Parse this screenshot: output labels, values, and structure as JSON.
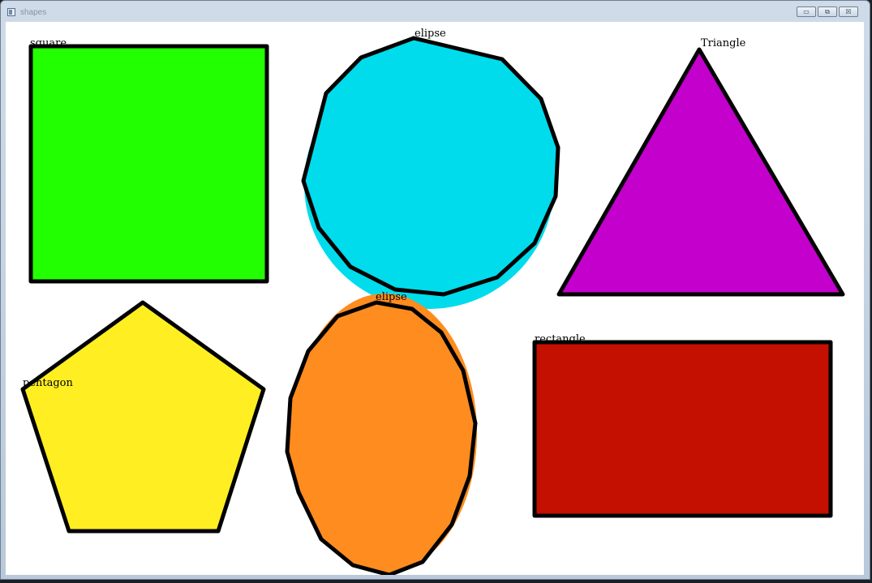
{
  "window": {
    "title": "shapes",
    "buttons": {
      "minimize": "▭",
      "maximize": "⧉",
      "close": "☒"
    }
  },
  "shapes": {
    "square": {
      "label": "square",
      "fill": "#22ff00"
    },
    "circle": {
      "label": "elipse",
      "fill": "#00dcec"
    },
    "triangle": {
      "label": "Triangle",
      "fill": "#c400cc"
    },
    "pentagon": {
      "label": "pentagon",
      "fill": "#ffee22"
    },
    "ellipse": {
      "label": "elipse",
      "fill": "#ff8c1e"
    },
    "rectangle": {
      "label": "rectangle",
      "fill": "#c41000"
    },
    "outline": "#000000"
  }
}
